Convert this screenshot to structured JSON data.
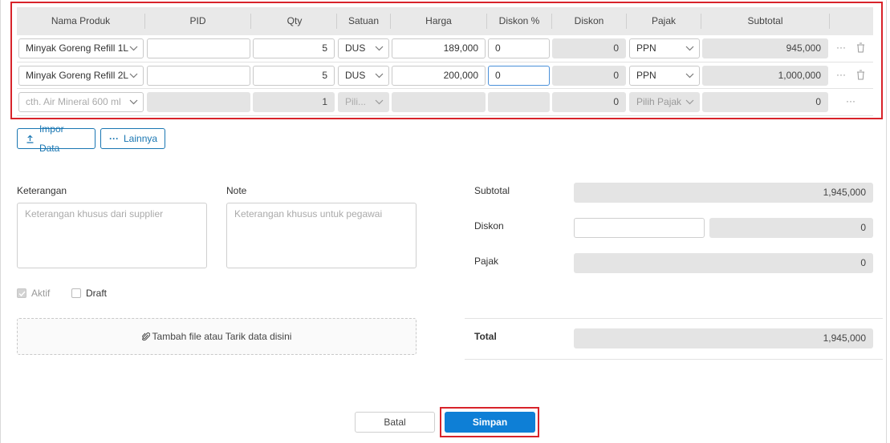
{
  "table": {
    "headers": [
      "Nama Produk",
      "PID",
      "Qty",
      "Satuan",
      "Harga",
      "Diskon %",
      "Diskon",
      "Pajak",
      "Subtotal"
    ],
    "rows": [
      {
        "product": "Minyak Goreng Refill 1L",
        "pid": "",
        "qty": "5",
        "unit": "DUS",
        "price": "189,000",
        "disc_pct": "0",
        "disc": "0",
        "tax": "PPN",
        "subtotal": "945,000"
      },
      {
        "product": "Minyak Goreng Refill 2L",
        "pid": "",
        "qty": "5",
        "unit": "DUS",
        "price": "200,000",
        "disc_pct": "0",
        "disc": "0",
        "tax": "PPN",
        "subtotal": "1,000,000"
      }
    ],
    "new_row": {
      "product_placeholder": "cth. Air Mineral 600 ml",
      "qty": "1",
      "unit_placeholder": "Pili...",
      "disc": "0",
      "tax_placeholder": "Pilih Pajak",
      "subtotal": "0"
    }
  },
  "actions": {
    "import_label": "Impor Data",
    "more_label": "Lainnya"
  },
  "form": {
    "keterangan_label": "Keterangan",
    "keterangan_placeholder": "Keterangan khusus dari supplier",
    "note_label": "Note",
    "note_placeholder": "Keterangan khusus untuk pegawai",
    "aktif_label": "Aktif",
    "draft_label": "Draft",
    "attach_label": "Tambah file atau Tarik data disini"
  },
  "summary": {
    "subtotal_label": "Subtotal",
    "subtotal_value": "1,945,000",
    "diskon_label": "Diskon",
    "diskon_value": "0",
    "pajak_label": "Pajak",
    "pajak_value": "0",
    "total_label": "Total",
    "total_value": "1,945,000"
  },
  "footer": {
    "cancel_label": "Batal",
    "save_label": "Simpan"
  },
  "colors": {
    "accent": "#0e7fd6",
    "highlight": "#d8232a"
  }
}
